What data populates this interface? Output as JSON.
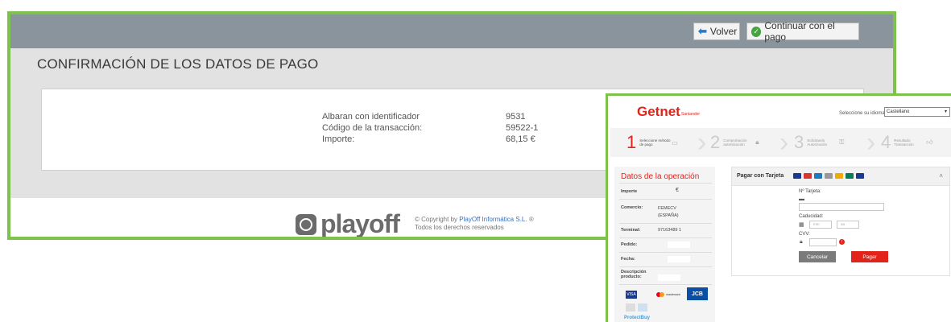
{
  "playoff_window": {
    "buttons": {
      "back": "Volver",
      "continue": "Continuar con el pago"
    },
    "title": "CONFIRMACIÓN DE LOS DATOS DE PAGO",
    "rows": [
      {
        "label": "Albaran con identificador",
        "value": "9531"
      },
      {
        "label": "Código de la transacción:",
        "value": "59522-1"
      },
      {
        "label": "Importe:",
        "value": "68,15 €"
      }
    ],
    "footer": {
      "logo_text": "playoff",
      "copyright_prefix": "© Copyright by ",
      "copyright_company": "PlayOff Informática S.L.",
      "copyright_suffix": " ®",
      "rights": "Todos los derechos reservados"
    }
  },
  "getnet_window": {
    "brand": "Getnet",
    "brand_sub": "Santander",
    "language_label": "Seleccione su idioma",
    "language_value": "Castellano",
    "steps": [
      {
        "num": "1",
        "label": "Seleccione método de pago"
      },
      {
        "num": "2",
        "label": "Comprobación autenticación"
      },
      {
        "num": "3",
        "label": "Solicitando Autorización"
      },
      {
        "num": "4",
        "label": "Resultado Transacción"
      }
    ],
    "operation": {
      "title": "Datos de la operación",
      "importe_label": "Importe",
      "importe_currency": "€",
      "comercio_label": "Comercio:",
      "comercio_value": "FEMECV (ESPAÑA)",
      "terminal_label": "Terminal:",
      "terminal_value": "97163489 1",
      "pedido_label": "Pedido:",
      "fecha_label": "Fecha:",
      "descripcion_label": "Descripción producto:"
    },
    "payment": {
      "title": "Pagar con Tarjeta",
      "card_number_label": "Nº Tarjeta:",
      "expiry_label": "Caducidad:",
      "month_placeholder": "mm",
      "year_placeholder": "aa",
      "cvv_label": "CVV:",
      "cancel": "Cancelar",
      "pay": "Pagar"
    },
    "badges": {
      "visa": "VISA",
      "mastercard": "mastercard",
      "jcb": "JCB",
      "protectbuy": "ProtectBuy"
    },
    "colors": {
      "brand_red": "#e2231a",
      "frame_green": "#7dc24b"
    }
  }
}
